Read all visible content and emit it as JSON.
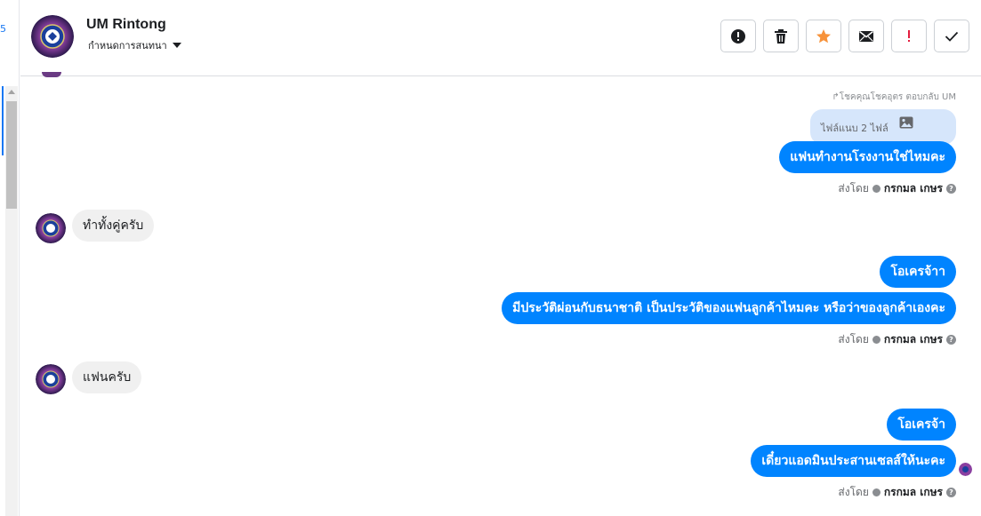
{
  "header": {
    "contact_name": "UM Rintong",
    "subtitle": "กำหนดการสนทนา",
    "buttons": [
      {
        "icon": "alert-circle-icon"
      },
      {
        "icon": "trash-icon"
      },
      {
        "icon": "star-icon",
        "color": "#f7923a"
      },
      {
        "icon": "envelope-icon"
      },
      {
        "icon": "exclamation-icon",
        "color": "#e41e3f"
      },
      {
        "icon": "check-icon"
      }
    ]
  },
  "chat": {
    "reply_note": "↱โชคคุณโชคอุตร ตอบกลับ UM",
    "file_label": "ไฟล์แนบ 2 ไฟล์",
    "msg1": "แฟนทำงานโรงงานใช่ไหมคะ",
    "sent_by_label": "ส่งโดย",
    "sender_name": "กรกมล เกษร",
    "in1": "ทำทั้งคู่ครับ",
    "msg2": "โอเครจ้าา",
    "msg3": "มีประวัติผ่อนกับธนาชาติ เป็นประวัติของแฟนลูกค้าไหมคะ หรือว่าของลูกค้าเองคะ",
    "in2": "แฟนครับ",
    "msg4": "โอเครจ้า",
    "msg5": "เดี๋ยวแอดมินประสานเซลส์ให้นะคะ"
  },
  "colors": {
    "outgoing_bubble": "#0084ff",
    "incoming_bubble": "#f0f0f0",
    "file_bubble": "#d6e6fb",
    "accent": "#1877f2"
  }
}
